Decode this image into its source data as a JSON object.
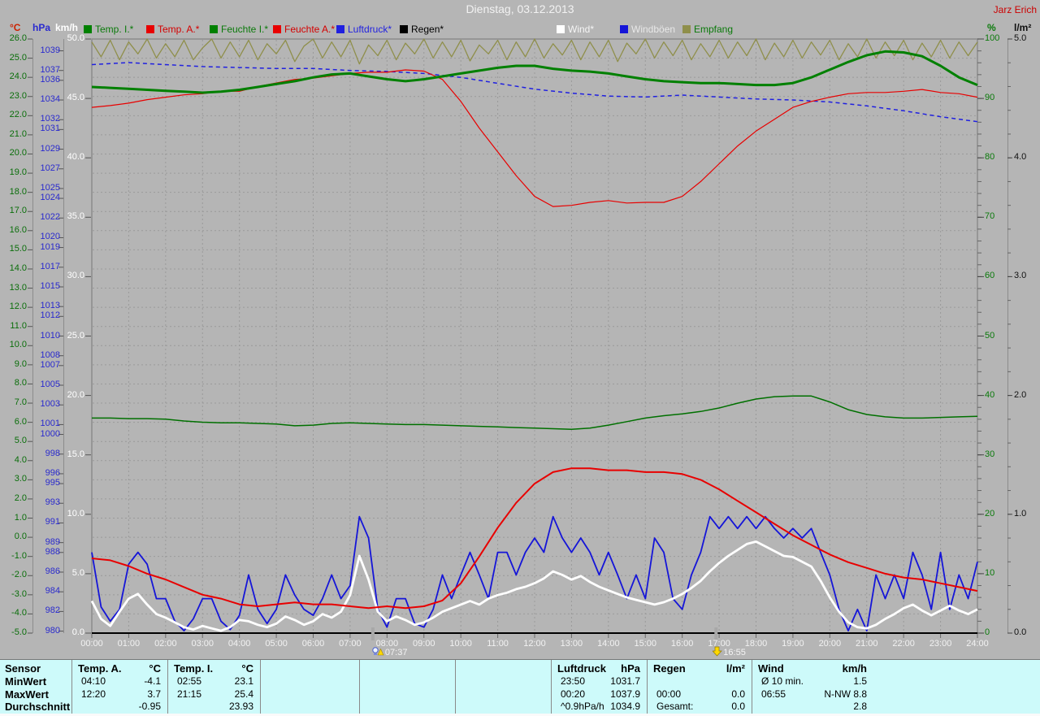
{
  "window": {
    "title": "Dienstag, 03.12.2013",
    "owner": "Jarz Erich"
  },
  "axis_headers": {
    "celsius": {
      "label": "°C",
      "color": "#cc2200"
    },
    "hpa": {
      "label": "hPa",
      "color": "#2a2ace"
    },
    "kmh": {
      "label": "km/h",
      "color": "#ffffff"
    },
    "percent": {
      "label": "%",
      "color": "#0a7a0a"
    },
    "lm2": {
      "label": "l/m²",
      "color": "#111111"
    }
  },
  "legend": {
    "items": [
      {
        "id": "temp_i",
        "label": "Temp. I.*",
        "swatch": "#008000",
        "labelColor": "#0a7a0a"
      },
      {
        "id": "temp_a",
        "label": "Temp. A.*",
        "swatch": "#e80000",
        "labelColor": "#d40000"
      },
      {
        "id": "feuchte_i",
        "label": "Feuchte I.*",
        "swatch": "#008000",
        "labelColor": "#0a7a0a"
      },
      {
        "id": "feuchte_a",
        "label": "Feuchte A.*",
        "swatch": "#e80000",
        "labelColor": "#d40000"
      },
      {
        "id": "luftdruck",
        "label": "Luftdruck*",
        "swatch": "#2020e0",
        "labelColor": "#2222e0"
      },
      {
        "id": "regen",
        "label": "Regen*",
        "swatch": "#000000",
        "labelColor": "#000000"
      },
      {
        "id": "wind",
        "label": "Wind*",
        "swatch": "#ffffff",
        "labelColor": "#f5f5f5"
      },
      {
        "id": "windboeen",
        "label": "Windböen",
        "swatch": "#1515d8",
        "labelColor": "#e8e8e8"
      },
      {
        "id": "empfang",
        "label": "Empfang",
        "swatch": "#8f8f4b",
        "labelColor": "#0a7a0a"
      }
    ]
  },
  "sun": {
    "sunrise": "07:37",
    "sunset": "16:55"
  },
  "axes_ticks": {
    "celsius": [
      "26.0",
      "25.0",
      "24.0",
      "23.0",
      "22.0",
      "21.0",
      "20.0",
      "19.0",
      "18.0",
      "17.0",
      "16.0",
      "15.0",
      "14.0",
      "13.0",
      "12.0",
      "11.0",
      "10.0",
      "9.0",
      "8.0",
      "7.0",
      "6.0",
      "5.0",
      "4.0",
      "3.0",
      "2.0",
      "1.0",
      "0.0",
      "-1.0",
      "-2.0",
      "-3.0",
      "-4.0",
      "-5.0"
    ],
    "hpa": [
      "1039",
      "1037",
      "1036",
      "1034",
      "1032",
      "1031",
      "1029",
      "1027",
      "1025",
      "1024",
      "1022",
      "1020",
      "1019",
      "1017",
      "1015",
      "1013",
      "1012",
      "1010",
      "1008",
      "1007",
      "1005",
      "1003",
      "1001",
      "1000",
      "998",
      "996",
      "995",
      "993",
      "991",
      "989",
      "988",
      "986",
      "984",
      "982",
      "980"
    ],
    "kmh": [
      "50.0",
      "45.0",
      "40.0",
      "35.0",
      "30.0",
      "25.0",
      "20.0",
      "15.0",
      "10.0",
      "5.0",
      "0.0"
    ],
    "percent": [
      "100",
      "90",
      "80",
      "70",
      "60",
      "50",
      "40",
      "30",
      "20",
      "10",
      "0"
    ],
    "lm2": [
      "5.0",
      "4.0",
      "3.0",
      "2.0",
      "1.0",
      "0.0"
    ],
    "time": [
      "00:00",
      "01:00",
      "02:00",
      "03:00",
      "04:00",
      "05:00",
      "06:00",
      "07:00",
      "08:00",
      "09:00",
      "10:00",
      "11:00",
      "12:00",
      "13:00",
      "14:00",
      "15:00",
      "16:00",
      "17:00",
      "18:00",
      "19:00",
      "20:00",
      "21:00",
      "22:00",
      "23:00",
      "24:00"
    ]
  },
  "chart_data": {
    "type": "line",
    "title": "Dienstag, 03.12.2013",
    "x_unit": "hours",
    "x_range": [
      0,
      24
    ],
    "grid": {
      "vertical_every_hours": 1,
      "horizontal_every_celsius": 1
    },
    "axes": [
      {
        "id": "celsius",
        "label": "°C",
        "min": -5,
        "max": 26,
        "side": "left"
      },
      {
        "id": "hpa",
        "label": "hPa",
        "min": 979.8,
        "max": 1040.2,
        "side": "left"
      },
      {
        "id": "kmh",
        "label": "km/h",
        "min": 0,
        "max": 50,
        "side": "left"
      },
      {
        "id": "percent",
        "label": "%",
        "min": 0,
        "max": 100,
        "side": "right"
      },
      {
        "id": "lm2",
        "label": "l/m²",
        "min": 0,
        "max": 5,
        "side": "right"
      }
    ],
    "series": [
      {
        "id": "empfang",
        "name": "Empfang",
        "axis": "percent",
        "color": "#8f8f4b",
        "width": 1.3,
        "step": 0.25,
        "values": [
          99.5,
          97.0,
          99.8,
          96.5,
          99.5,
          97.5,
          100,
          96.8,
          99.2,
          97.0,
          99.8,
          96.5,
          98.5,
          100,
          96.8,
          99.5,
          97.0,
          99.8,
          96.5,
          99.2,
          97.5,
          99.8,
          96.2,
          98.8,
          100,
          96.8,
          99.5,
          97.0,
          99.8,
          95.8,
          99.0,
          97.2,
          99.8,
          96.5,
          99.3,
          97.5,
          100,
          96.8,
          99.5,
          97.0,
          99.8,
          96.3,
          99.0,
          97.5,
          99.8,
          96.5,
          99.5,
          97.0,
          100,
          96.8,
          99.2,
          97.3,
          99.8,
          96.5,
          99.5,
          97.0,
          99.8,
          96.2,
          99.3,
          97.5,
          100,
          96.8,
          99.5,
          97.2,
          99.8,
          96.5,
          99.2,
          97.0,
          99.8,
          96.8,
          99.5,
          97.2,
          100,
          96.5,
          99.3,
          97.0,
          99.8,
          96.8,
          99.5,
          97.3,
          99.8,
          96.5,
          99.2,
          97.0,
          100,
          96.8,
          99.5,
          97.2,
          99.8,
          96.5,
          99.3,
          97.0,
          99.8,
          96.8,
          99.5,
          97.2,
          99.5
        ]
      },
      {
        "id": "luftdruck",
        "name": "Luftdruck",
        "axis": "hpa",
        "color": "#2020e0",
        "width": 1.5,
        "dash": "5 4",
        "step": 1,
        "values": [
          1037.6,
          1037.8,
          1037.6,
          1037.4,
          1037.3,
          1037.2,
          1037.2,
          1037.0,
          1036.9,
          1036.7,
          1036.3,
          1035.7,
          1035.1,
          1034.7,
          1034.4,
          1034.3,
          1034.5,
          1034.3,
          1034.1,
          1034.0,
          1033.8,
          1033.4,
          1032.9,
          1032.3,
          1031.8
        ]
      },
      {
        "id": "feuchte_a",
        "name": "Feuchte A.",
        "axis": "percent",
        "color": "#e80000",
        "width": 1.2,
        "step": 0.5,
        "values": [
          88.5,
          88.8,
          89.2,
          89.8,
          90.2,
          90.6,
          90.8,
          91.2,
          91.2,
          92.0,
          92.6,
          93.2,
          93.4,
          93.8,
          94.2,
          94.4,
          94.4,
          94.8,
          94.6,
          93.2,
          89.5,
          85.0,
          81.0,
          77.0,
          73.5,
          71.8,
          72.0,
          72.5,
          72.8,
          72.4,
          72.5,
          72.5,
          73.5,
          76.0,
          79.0,
          82.0,
          84.5,
          86.5,
          88.5,
          89.5,
          90.2,
          90.8,
          91.0,
          91.0,
          91.2,
          91.5,
          91.0,
          90.8,
          90.2
        ]
      },
      {
        "id": "feuchte_i",
        "name": "Feuchte I.",
        "axis": "percent",
        "color": "#007000",
        "width": 1.5,
        "step": 0.5,
        "values": [
          36.2,
          36.2,
          36.1,
          36.1,
          36.0,
          35.7,
          35.5,
          35.4,
          35.4,
          35.3,
          35.2,
          34.9,
          35.0,
          35.3,
          35.4,
          35.3,
          35.2,
          35.1,
          35.1,
          35.0,
          34.9,
          34.8,
          34.7,
          34.6,
          34.5,
          34.4,
          34.3,
          34.5,
          35.0,
          35.6,
          36.2,
          36.6,
          36.9,
          37.3,
          37.9,
          38.7,
          39.4,
          39.8,
          39.9,
          39.9,
          38.9,
          37.6,
          36.8,
          36.4,
          36.2,
          36.2,
          36.3,
          36.4,
          36.5
        ]
      },
      {
        "id": "temp_i",
        "name": "Temp. I.",
        "axis": "celsius",
        "color": "#008000",
        "width": 3,
        "step": 0.5,
        "values": [
          23.5,
          23.45,
          23.4,
          23.35,
          23.3,
          23.25,
          23.2,
          23.25,
          23.35,
          23.5,
          23.65,
          23.8,
          24.0,
          24.15,
          24.2,
          24.05,
          23.9,
          23.8,
          23.9,
          24.05,
          24.2,
          24.35,
          24.5,
          24.6,
          24.6,
          24.45,
          24.35,
          24.3,
          24.2,
          24.05,
          23.9,
          23.8,
          23.75,
          23.7,
          23.7,
          23.65,
          23.6,
          23.6,
          23.7,
          24.0,
          24.4,
          24.8,
          25.15,
          25.35,
          25.3,
          25.1,
          24.6,
          24.0,
          23.6
        ]
      },
      {
        "id": "windboeen",
        "name": "Windböen",
        "axis": "kmh",
        "color": "#1515d8",
        "width": 1.8,
        "step": 0.25,
        "values": [
          6.8,
          2.2,
          1.0,
          2.0,
          5.8,
          6.8,
          5.8,
          2.9,
          2.9,
          1.0,
          0.2,
          1.2,
          2.9,
          2.9,
          1.0,
          0.3,
          1.5,
          4.9,
          2.0,
          0.8,
          2.0,
          4.9,
          3.2,
          2.0,
          1.5,
          2.9,
          4.9,
          2.9,
          4.0,
          9.8,
          8.0,
          2.0,
          0.5,
          2.9,
          2.9,
          0.8,
          0.5,
          2.0,
          4.9,
          2.9,
          4.9,
          6.8,
          4.9,
          2.9,
          6.8,
          6.8,
          4.9,
          6.8,
          8.0,
          6.8,
          9.8,
          8.0,
          6.8,
          8.0,
          6.8,
          4.9,
          6.8,
          4.9,
          2.9,
          4.9,
          2.9,
          8.0,
          6.8,
          2.9,
          2.0,
          4.9,
          6.8,
          9.8,
          8.8,
          9.8,
          8.8,
          9.8,
          8.8,
          9.8,
          8.8,
          8.0,
          8.8,
          8.0,
          8.8,
          6.8,
          4.9,
          2.0,
          0.2,
          2.0,
          0.2,
          4.9,
          2.9,
          4.9,
          2.9,
          6.8,
          4.9,
          2.0,
          6.8,
          2.0,
          4.9,
          2.9,
          6.0
        ]
      },
      {
        "id": "wind",
        "name": "Wind",
        "axis": "kmh",
        "color": "#ffffff",
        "width": 2.8,
        "step": 0.25,
        "values": [
          2.7,
          1.2,
          0.6,
          1.8,
          2.9,
          3.3,
          2.4,
          1.6,
          1.3,
          0.9,
          0.5,
          0.3,
          0.6,
          0.4,
          0.2,
          0.5,
          1.1,
          1.0,
          0.7,
          0.5,
          0.8,
          1.4,
          1.1,
          0.7,
          1.0,
          1.6,
          1.3,
          1.8,
          3.2,
          6.5,
          4.5,
          1.8,
          1.0,
          1.4,
          1.1,
          0.7,
          0.9,
          1.3,
          1.8,
          2.1,
          2.4,
          2.7,
          2.4,
          2.9,
          3.2,
          3.4,
          3.7,
          3.9,
          4.2,
          4.6,
          5.2,
          4.9,
          4.5,
          4.8,
          4.3,
          3.9,
          3.6,
          3.3,
          3.0,
          2.8,
          2.6,
          2.4,
          2.6,
          2.9,
          3.3,
          3.8,
          4.4,
          5.2,
          5.9,
          6.5,
          7.0,
          7.5,
          7.7,
          7.3,
          6.9,
          6.5,
          6.4,
          6.0,
          5.6,
          4.4,
          3.0,
          1.8,
          0.9,
          0.5,
          0.4,
          0.7,
          1.2,
          1.6,
          2.1,
          2.4,
          1.9,
          1.5,
          1.9,
          2.3,
          1.9,
          1.6,
          2.0
        ]
      },
      {
        "id": "temp_a",
        "name": "Temp. A.",
        "axis": "celsius",
        "color": "#e80000",
        "width": 2,
        "step": 0.5,
        "values": [
          -1.1,
          -1.2,
          -1.5,
          -1.9,
          -2.2,
          -2.6,
          -3.0,
          -3.2,
          -3.5,
          -3.6,
          -3.5,
          -3.4,
          -3.5,
          -3.5,
          -3.6,
          -3.7,
          -3.6,
          -3.7,
          -3.6,
          -3.3,
          -2.4,
          -1.0,
          0.5,
          1.8,
          2.8,
          3.4,
          3.6,
          3.6,
          3.5,
          3.5,
          3.4,
          3.4,
          3.3,
          3.0,
          2.5,
          1.9,
          1.3,
          0.7,
          0.1,
          -0.4,
          -0.9,
          -1.3,
          -1.6,
          -1.9,
          -2.1,
          -2.2,
          -2.4,
          -2.6,
          -2.8
        ]
      },
      {
        "id": "regen",
        "name": "Regen",
        "axis": "lm2",
        "color": "#000000",
        "width": 1.5,
        "step": 12,
        "values": [
          0,
          0,
          0
        ]
      }
    ]
  },
  "table": {
    "row_labels": [
      "Sensor",
      "MinWert",
      "MaxWert",
      "Durchschnitt"
    ],
    "columns": [
      {
        "header": "Temp. A.",
        "unit": "°C",
        "rows": [
          [
            "04:10",
            "-4.1"
          ],
          [
            "12:20",
            "3.7"
          ],
          [
            "",
            "-0.95"
          ]
        ]
      },
      {
        "header": "Temp. I.",
        "unit": "°C",
        "rows": [
          [
            "02:55",
            "23.1"
          ],
          [
            "21:15",
            "25.4"
          ],
          [
            "",
            "23.93"
          ]
        ]
      },
      {
        "header": "",
        "unit": "",
        "rows": [
          [
            "",
            ""
          ],
          [
            "",
            ""
          ],
          [
            "",
            ""
          ]
        ]
      },
      {
        "header": "",
        "unit": "",
        "rows": [
          [
            "",
            ""
          ],
          [
            "",
            ""
          ],
          [
            "",
            ""
          ]
        ]
      },
      {
        "header": "",
        "unit": "",
        "rows": [
          [
            "",
            ""
          ],
          [
            "",
            ""
          ],
          [
            "",
            ""
          ]
        ]
      },
      {
        "header": "Luftdruck",
        "unit": "hPa",
        "rows": [
          [
            "23:50",
            "1031.7"
          ],
          [
            "00:20",
            "1037.9"
          ],
          [
            "^0.9hPa/h",
            "1034.9"
          ]
        ]
      },
      {
        "header": "Regen",
        "unit": "l/m²",
        "rows": [
          [
            "",
            ""
          ],
          [
            "00:00",
            "0.0"
          ],
          [
            "Gesamt:",
            "0.0"
          ]
        ]
      },
      {
        "header": "Wind",
        "unit": "km/h",
        "rows": [
          [
            "Ø 10 min.",
            "1.5"
          ],
          [
            "06:55",
            "N-NW 8.8"
          ],
          [
            "",
            "2.8"
          ]
        ]
      }
    ]
  }
}
